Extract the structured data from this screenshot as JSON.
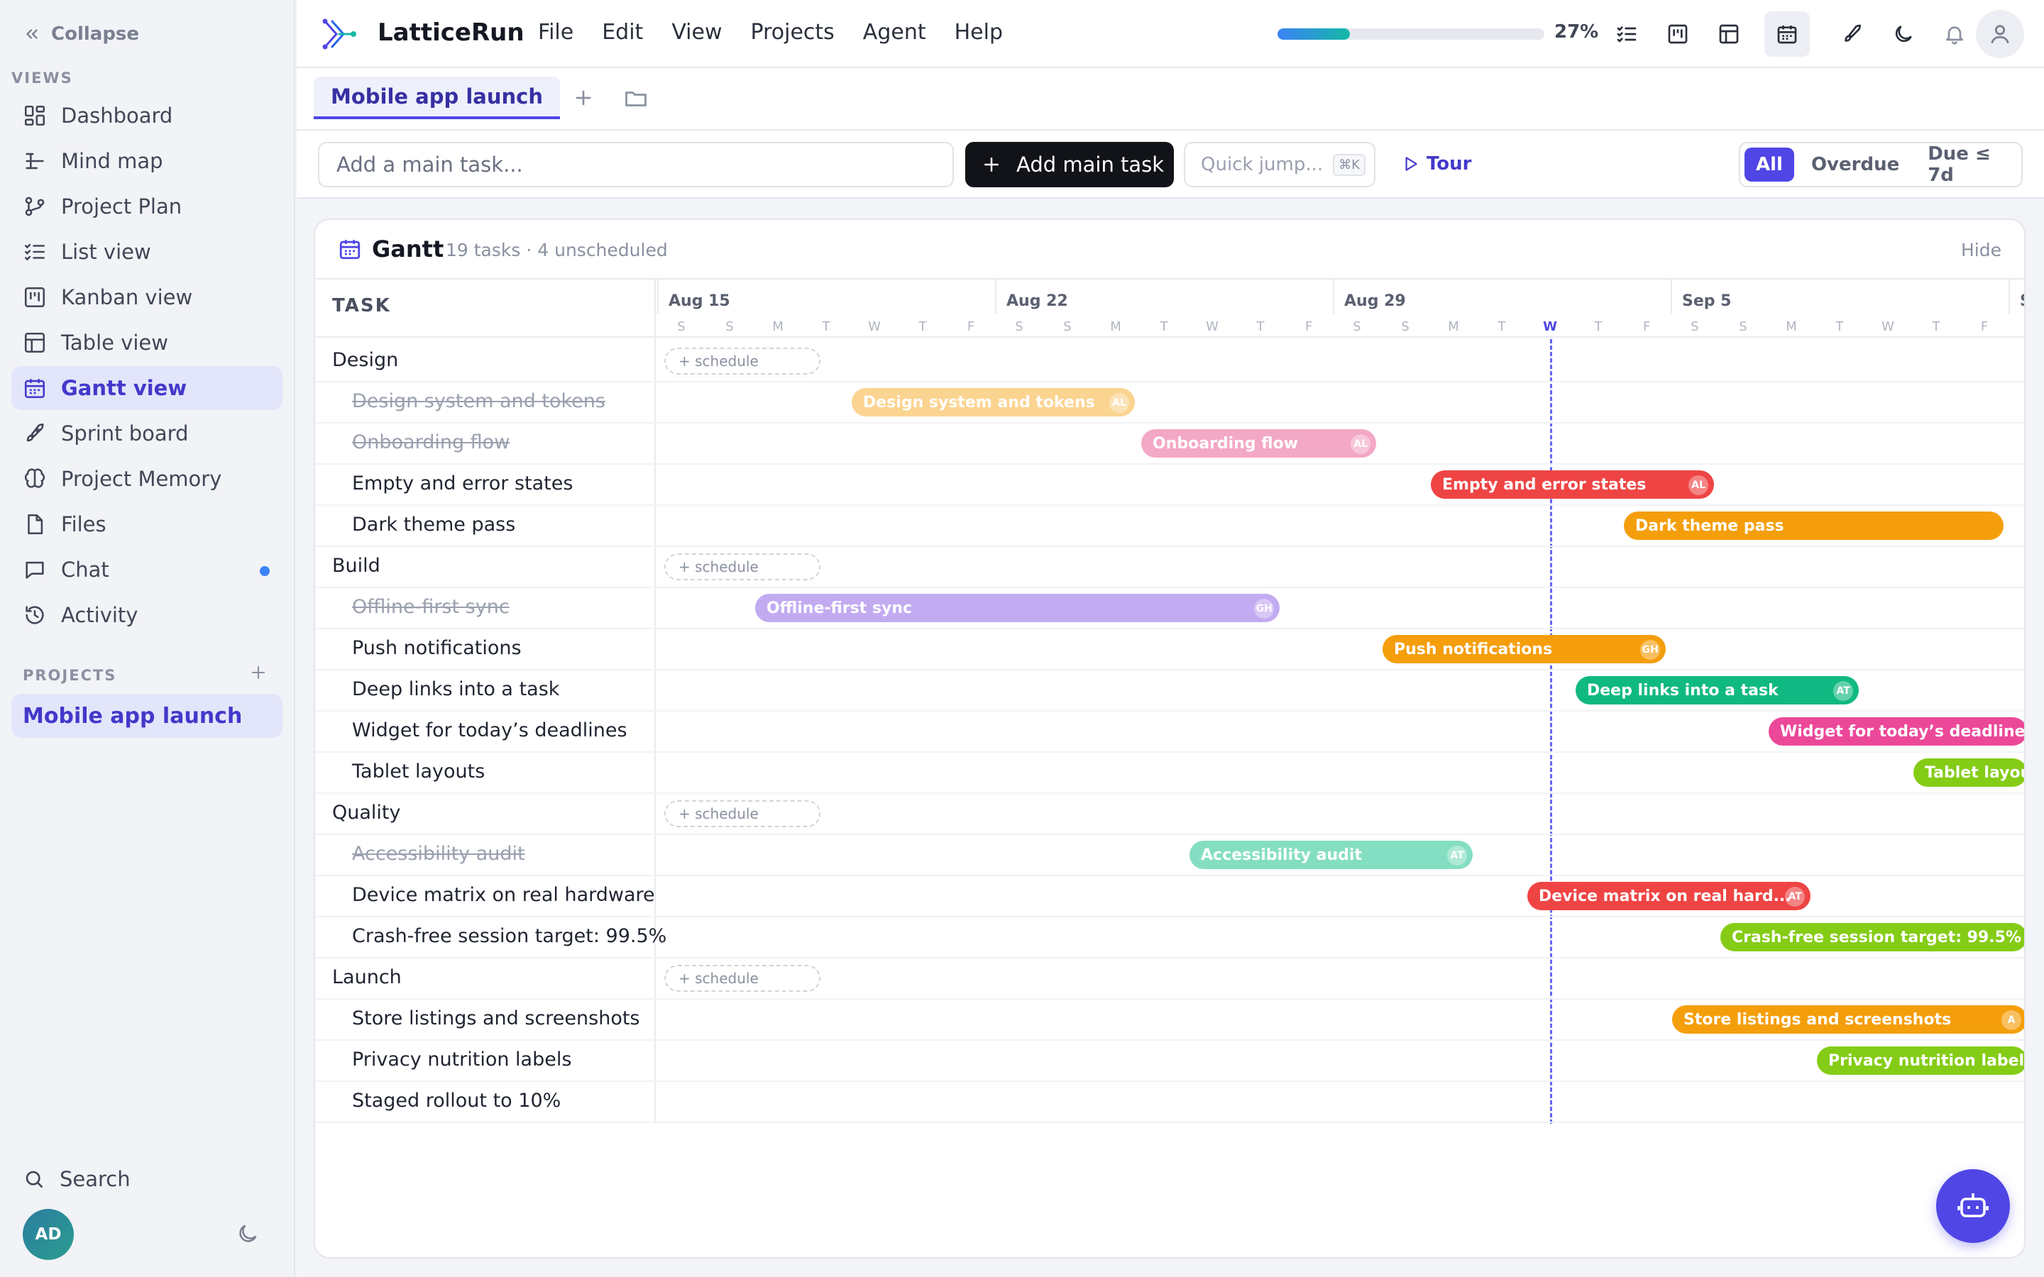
{
  "sidebar": {
    "collapse_label": "Collapse",
    "views_label": "VIEWS",
    "items": [
      {
        "label": "Dashboard",
        "icon": "dashboard-icon"
      },
      {
        "label": "Mind map",
        "icon": "mind-map-icon"
      },
      {
        "label": "Project Plan",
        "icon": "project-plan-icon"
      },
      {
        "label": "List view",
        "icon": "list-icon"
      },
      {
        "label": "Kanban view",
        "icon": "kanban-icon"
      },
      {
        "label": "Table view",
        "icon": "table-icon"
      },
      {
        "label": "Gantt view",
        "icon": "calendar-icon",
        "active": true
      },
      {
        "label": "Sprint board",
        "icon": "rocket-icon"
      },
      {
        "label": "Project Memory",
        "icon": "brain-icon"
      },
      {
        "label": "Files",
        "icon": "file-icon"
      },
      {
        "label": "Chat",
        "icon": "chat-icon",
        "unread": true
      },
      {
        "label": "Activity",
        "icon": "history-icon"
      }
    ],
    "projects_label": "PROJECTS",
    "project": "Mobile app launch",
    "search_label": "Search",
    "avatar_initials": "AD"
  },
  "topbar": {
    "brand": "LatticeRun",
    "menu": [
      "File",
      "Edit",
      "View",
      "Projects",
      "Agent",
      "Help"
    ],
    "progress_percent": 27,
    "progress_label": "27%"
  },
  "tabs": {
    "active": "Mobile app launch"
  },
  "actionbar": {
    "input_placeholder": "Add a main task...",
    "add_button": "Add main task",
    "quick_jump": "Quick jump...",
    "quick_jump_kbd": "⌘K",
    "tour": "Tour",
    "filters": [
      "All",
      "Overdue",
      "Due ≤ 7d"
    ],
    "active_filter": "All"
  },
  "gantt": {
    "title": "Gantt",
    "subtitle": "19 tasks · 4 unscheduled",
    "hide": "Hide",
    "task_header": "TASK",
    "schedule_label": "+ schedule",
    "months": [
      "Aug 15",
      "Aug 22",
      "Aug 29",
      "Sep 5",
      "S"
    ],
    "day_letters": [
      "S",
      "S",
      "M",
      "T",
      "W",
      "T",
      "F",
      "S",
      "S",
      "M",
      "T",
      "W",
      "T",
      "F",
      "S",
      "S",
      "M",
      "T",
      "W",
      "T",
      "F",
      "S",
      "S",
      "M",
      "T",
      "W",
      "T",
      "F"
    ],
    "today_index": 18,
    "rows": [
      {
        "label": "Design",
        "group": true
      },
      {
        "label": "Design system and tokens",
        "done": true,
        "start": 4,
        "end": 9.9,
        "color": "#f9b949",
        "assignee": "AL"
      },
      {
        "label": "Onboarding flow",
        "done": true,
        "start": 10,
        "end": 14.9,
        "color": "#ec6fa0",
        "assignee": "AL"
      },
      {
        "label": "Empty and error states",
        "start": 16,
        "end": 21.9,
        "color": "#ef4444",
        "assignee": "AL"
      },
      {
        "label": "Dark theme pass",
        "start": 20,
        "end": 27.9,
        "color": "#f59e0b",
        "assignee": ""
      },
      {
        "label": "Build",
        "group": true
      },
      {
        "label": "Offline-first sync",
        "done": true,
        "start": 2,
        "end": 12.9,
        "color": "#9b74e8",
        "assignee": "GH"
      },
      {
        "label": "Push notifications",
        "start": 15,
        "end": 20.9,
        "color": "#f59e0b",
        "assignee": "GH"
      },
      {
        "label": "Deep links into a task",
        "start": 19,
        "end": 24.9,
        "color": "#10b981",
        "assignee": "AT"
      },
      {
        "label": "Widget for today’s deadlines",
        "start": 23,
        "end": 29,
        "color": "#ec4899",
        "assignee": ""
      },
      {
        "label": "Tablet layouts",
        "start": 26,
        "end": 30,
        "color": "#84cc16",
        "assignee": ""
      },
      {
        "label": "Quality",
        "group": true
      },
      {
        "label": "Accessibility audit",
        "done": true,
        "start": 11,
        "end": 16.9,
        "color": "#34c99a",
        "assignee": "AT"
      },
      {
        "label": "Device matrix on real hardware",
        "start": 18,
        "end": 23.9,
        "color": "#ef4444",
        "assignee": "AT",
        "bar_label": "Device matrix on real hard..."
      },
      {
        "label": "Crash-free session target: 99.5%",
        "start": 22,
        "end": 30,
        "color": "#84cc16",
        "assignee": ""
      },
      {
        "label": "Launch",
        "group": true
      },
      {
        "label": "Store listings and screenshots",
        "start": 21,
        "end": 30,
        "color": "#f59e0b",
        "assignee": "A"
      },
      {
        "label": "Privacy nutrition labels",
        "start": 24,
        "end": 30,
        "color": "#84cc16",
        "assignee": ""
      },
      {
        "label": "Staged rollout to 10%",
        "start": null,
        "end": null,
        "color": "",
        "assignee": ""
      }
    ]
  }
}
